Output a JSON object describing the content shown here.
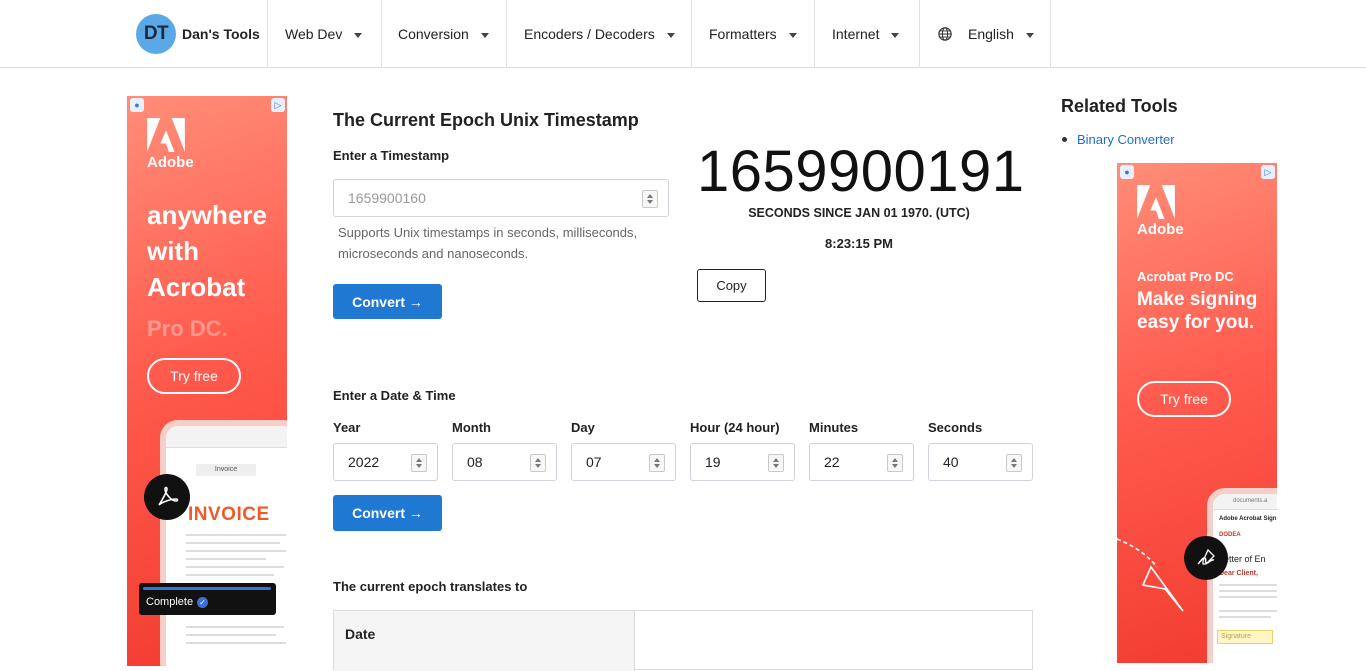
{
  "nav": {
    "brand_initials": "DT",
    "brand_name": "Dan's Tools",
    "items": [
      {
        "label": "Web Dev"
      },
      {
        "label": "Conversion"
      },
      {
        "label": "Encoders / Decoders"
      },
      {
        "label": "Formatters"
      },
      {
        "label": "Internet"
      },
      {
        "label": "English"
      }
    ]
  },
  "ad_left": {
    "brand": "Adobe",
    "headline_1": "anywhere",
    "headline_2": "with",
    "headline_3": "Acrobat",
    "headline_4": "Pro DC.",
    "cta": "Try free",
    "doc_title": "INVOICE",
    "doc_tab": "Invoice",
    "status": "Complete"
  },
  "ad_right": {
    "brand": "Adobe",
    "product": "Acrobat Pro DC",
    "headline": "Make signing easy for you.",
    "cta": "Try free",
    "doc_header": "Adobe Acrobat Sign",
    "doc_brand": "DODEA",
    "doc_title": "Letter of En",
    "doc_greeting": "Dear Client,",
    "signature_label": "Signature",
    "url": "documents.a"
  },
  "main": {
    "title": "The Current Epoch Unix Timestamp",
    "enter_label": "Enter a Timestamp",
    "timestamp_placeholder": "1659900160",
    "help_text": "Supports Unix timestamps in seconds, milliseconds, microseconds and nanoseconds.",
    "convert_label": "Convert →",
    "current_timestamp": "1659900191",
    "since_label": "SECONDS SINCE JAN 01 1970. (UTC)",
    "current_time": "8:23:15 PM",
    "copy_label": "Copy",
    "date_section_label": "Enter a Date & Time",
    "date_fields": [
      {
        "label": "Year",
        "value": "2022"
      },
      {
        "label": "Month",
        "value": "08"
      },
      {
        "label": "Day",
        "value": "07"
      },
      {
        "label": "Hour (24 hour)",
        "value": "19"
      },
      {
        "label": "Minutes",
        "value": "22"
      },
      {
        "label": "Seconds",
        "value": "40"
      }
    ],
    "convert2_label": "Convert →",
    "translates_label": "The current epoch translates to",
    "table_first_header": "Date"
  },
  "related": {
    "title": "Related Tools",
    "items": [
      {
        "label": "Binary Converter"
      }
    ]
  },
  "colors": {
    "primary": "#1f78d1",
    "link": "#1f6fc5",
    "logo": "#5aa9e6",
    "ad": "#f23a2f"
  }
}
